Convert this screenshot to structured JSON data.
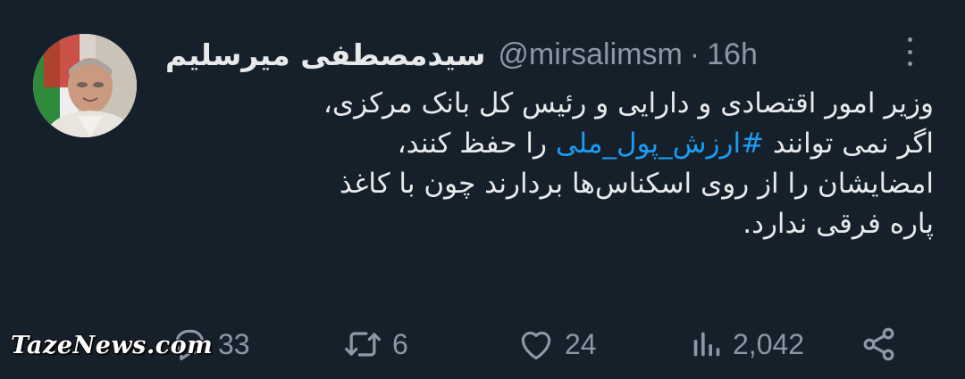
{
  "tweet": {
    "author": {
      "display_name": "سیدمصطفی میرسلیم",
      "handle": "@mirsalimsm",
      "time": "16h"
    },
    "separator": "·",
    "text": {
      "line1": "وزیر امور اقتصادی و دارایی و رئیس کل بانک مرکزی،",
      "line2_before": "اگر نمی توانند ",
      "hashtag": "#ارزش_پول_ملی",
      "line2_after": " را حفظ کنند،",
      "line3": "امضایشان را از روی اسکناس‌ها بردارند چون با کاغذ",
      "line4": "پاره فرقی ندارد."
    },
    "actions": {
      "replies": "33",
      "retweets": "6",
      "likes": "24",
      "views": "2,042"
    },
    "colors": {
      "background": "#15202b",
      "text": "#e7e9ea",
      "secondary": "#8b98a5",
      "link": "#1d9bf0"
    }
  },
  "watermark": {
    "text": "TazeNews.com"
  }
}
